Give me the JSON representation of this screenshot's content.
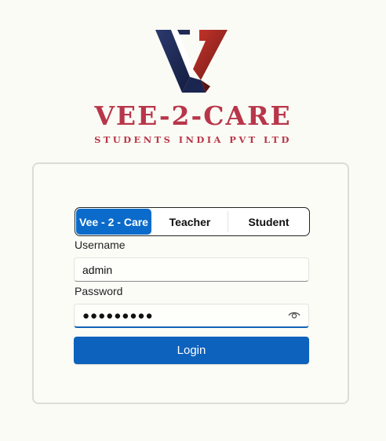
{
  "brand": {
    "name": "VEE-2-CARE",
    "subtitle": "STUDENTS INDIA PVT LTD",
    "color": "#b8364a",
    "logo": "v-monogram-logo"
  },
  "login": {
    "tabs": [
      {
        "label": "Vee - 2 - Care",
        "selected": true
      },
      {
        "label": "Teacher",
        "selected": false
      },
      {
        "label": "Student",
        "selected": false
      }
    ],
    "username_label": "Username",
    "username_value": "admin",
    "password_label": "Password",
    "password_value": "●●●●●●●●●",
    "reveal_icon": "eye-icon",
    "submit_label": "Login",
    "accent": "#0d62bd"
  }
}
